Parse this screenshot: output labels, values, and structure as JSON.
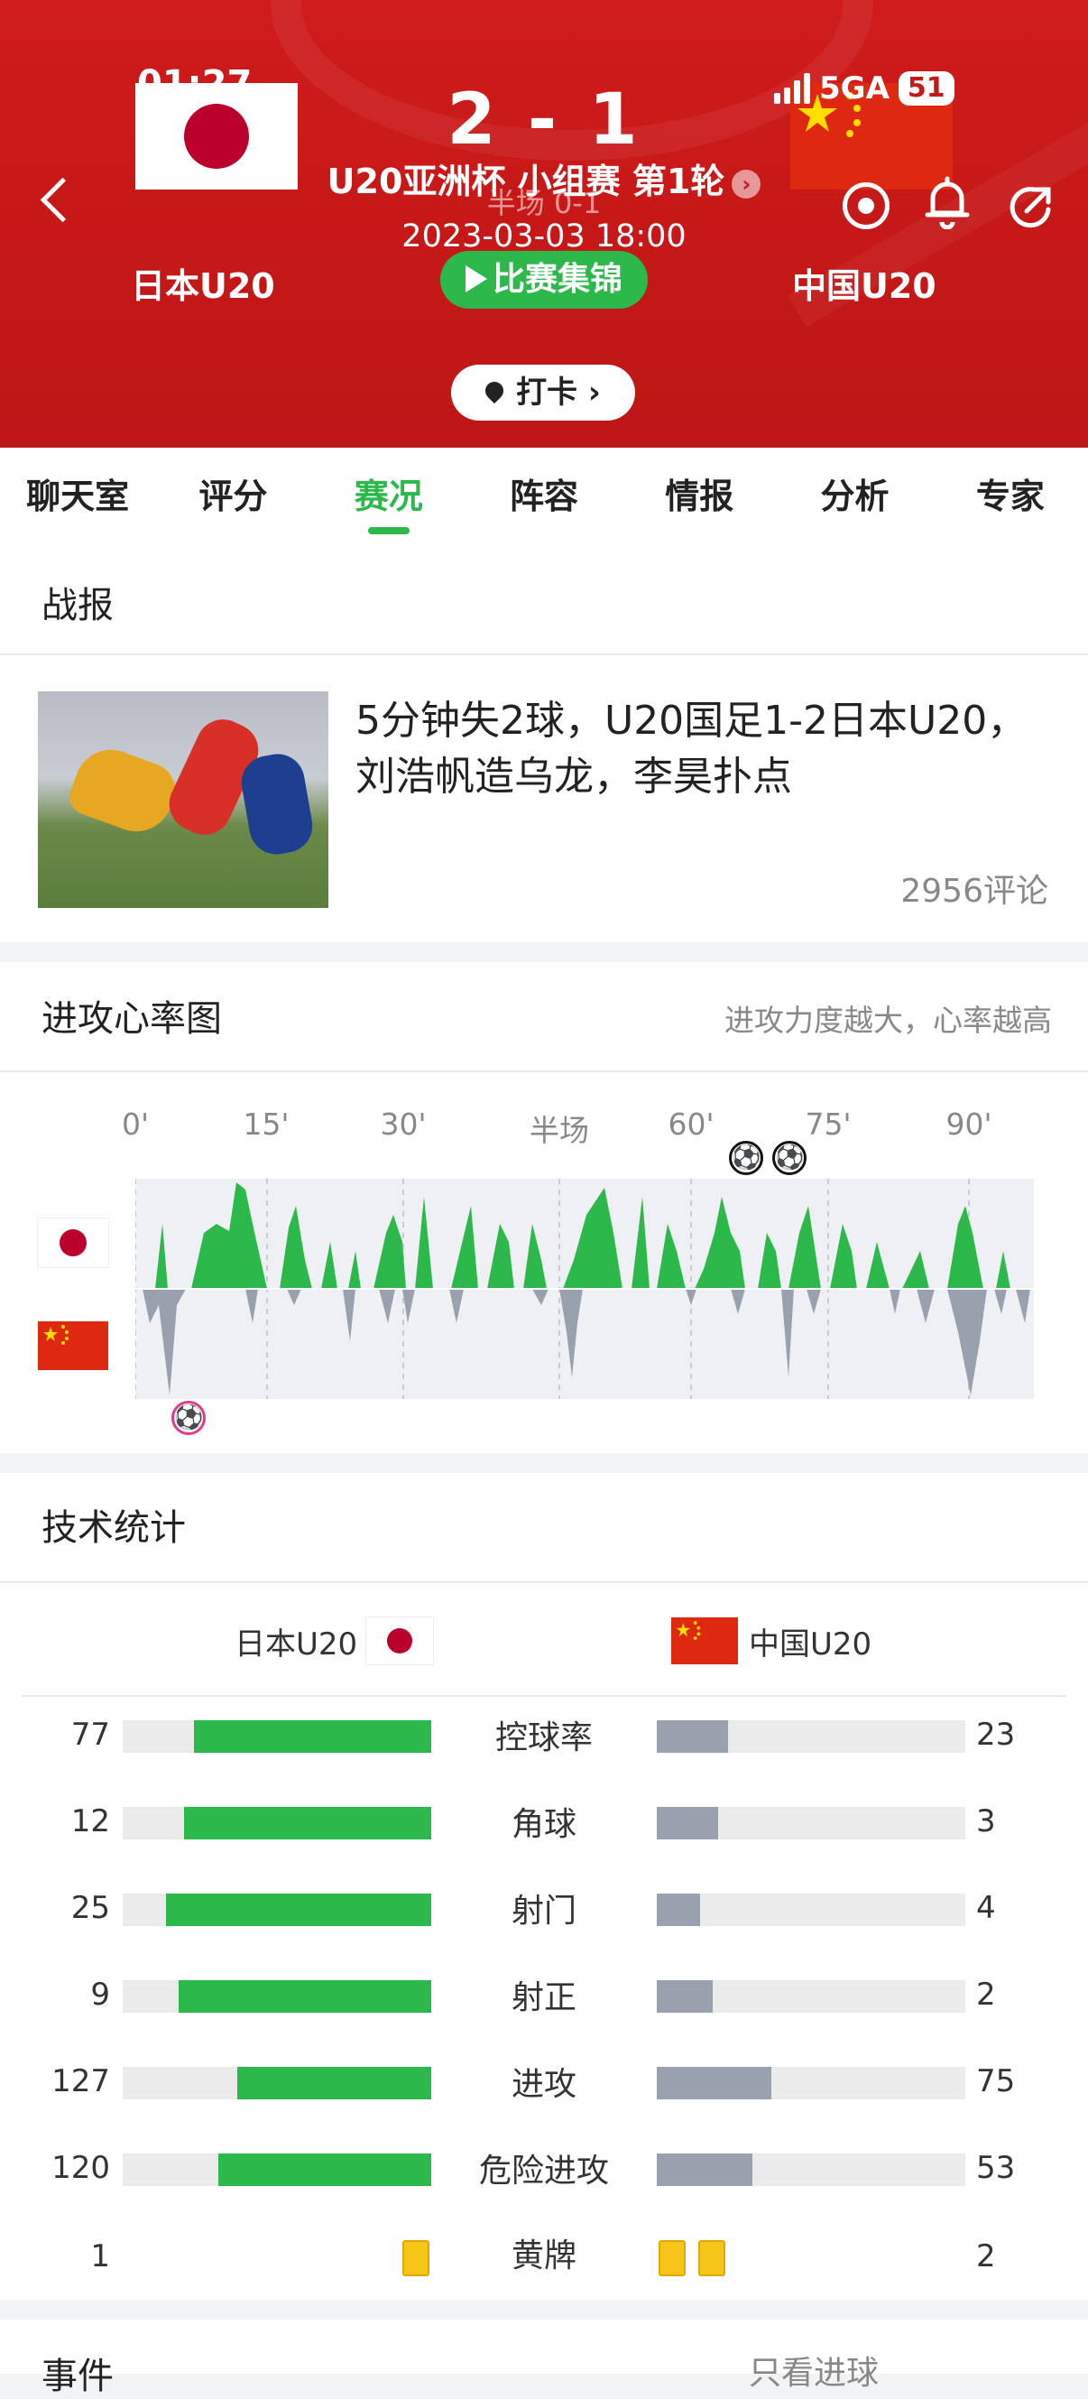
{
  "status": {
    "time": "01:27",
    "network": "5GA",
    "battery": "51"
  },
  "match": {
    "score": "2 - 1",
    "league": "U20亚洲杯 小组赛 第1轮",
    "half_time": "半场 0-1",
    "datetime": "2023-03-03 18:00",
    "home_team": "日本U20",
    "away_team": "中国U20",
    "highlights_label": "比赛集锦",
    "checkin_label": "打卡"
  },
  "tabs": [
    "聊天室",
    "评分",
    "赛况",
    "阵容",
    "情报",
    "分析",
    "专家"
  ],
  "active_tab": "赛况",
  "report": {
    "section_title": "战报",
    "headline": "5分钟失2球，U20国足1-2日本U20，刘浩帆造乌龙，李昊扑点",
    "comments": "2956评论"
  },
  "heart_rate": {
    "section_title": "进攻心率图",
    "subtitle": "进攻力度越大，心率越高",
    "ticks": [
      "0'",
      "15'",
      "30'",
      "半场",
      "60'",
      "75'",
      "90'"
    ]
  },
  "tech_stats": {
    "section_title": "技术统计",
    "home_label": "日本U20",
    "away_label": "中国U20",
    "rows": [
      {
        "label": "控球率",
        "home": "77",
        "away": "23",
        "home_frac": 0.77,
        "away_frac": 0.23
      },
      {
        "label": "角球",
        "home": "12",
        "away": "3",
        "home_frac": 0.8,
        "away_frac": 0.2
      },
      {
        "label": "射门",
        "home": "25",
        "away": "4",
        "home_frac": 0.86,
        "away_frac": 0.14
      },
      {
        "label": "射正",
        "home": "9",
        "away": "2",
        "home_frac": 0.82,
        "away_frac": 0.18
      },
      {
        "label": "进攻",
        "home": "127",
        "away": "75",
        "home_frac": 0.63,
        "away_frac": 0.37
      },
      {
        "label": "危险进攻",
        "home": "120",
        "away": "53",
        "home_frac": 0.69,
        "away_frac": 0.31
      }
    ],
    "yellow": {
      "label": "黄牌",
      "home": "1",
      "away": "2"
    }
  },
  "events": {
    "section_title": "事件",
    "filter_label": "只看进球"
  },
  "colors": {
    "header_red": "#c51818",
    "accent_green": "#2db84b",
    "away_gray": "#9aa1ae"
  }
}
